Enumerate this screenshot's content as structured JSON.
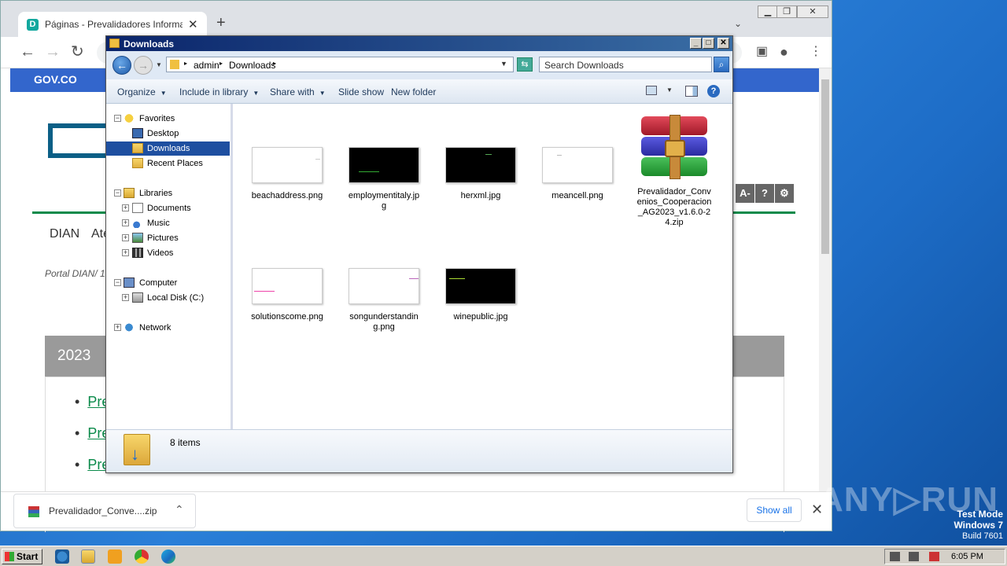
{
  "chrome": {
    "tab_title": "Páginas - Prevalidadores Informacion",
    "tab_favicon": "D",
    "new_tab_symbol": "+",
    "tab_close": "✕",
    "back": "←",
    "forward": "→",
    "reload": "↻"
  },
  "webpage": {
    "gov_label": "GOV.CO",
    "menu_dian": "DIAN",
    "menu_partial": "Ate",
    "breadcrumb": "Portal DIAN/   1",
    "year_heading": "2023",
    "link_items": [
      "Pre",
      "Pre",
      "Pre"
    ],
    "access_buttons": [
      "A-",
      "?",
      "⚙"
    ]
  },
  "download_shelf": {
    "item_name": "Prevalidador_Conve....zip",
    "show_all": "Show all",
    "close": "✕"
  },
  "explorer": {
    "title": "Downloads",
    "path": [
      "admin",
      "Downloads"
    ],
    "search_placeholder": "Search Downloads",
    "commands": {
      "organize": "Organize",
      "include_library": "Include in library",
      "share_with": "Share with",
      "slide_show": "Slide show",
      "new_folder": "New folder"
    },
    "nav": {
      "favorites": "Favorites",
      "desktop": "Desktop",
      "downloads": "Downloads",
      "recent_places": "Recent Places",
      "libraries": "Libraries",
      "documents": "Documents",
      "music": "Music",
      "pictures": "Pictures",
      "videos": "Videos",
      "computer": "Computer",
      "local_disk": "Local Disk (C:)",
      "network": "Network"
    },
    "files": [
      {
        "name": "beachaddress.png",
        "thumb": "white"
      },
      {
        "name": "employmentitaly.jpg",
        "thumb": "black"
      },
      {
        "name": "herxml.jpg",
        "thumb": "black"
      },
      {
        "name": "meancell.png",
        "thumb": "white"
      },
      {
        "name": "Prevalidador_Convenios_Cooperacion_AG2023_v1.6.0-24.zip",
        "thumb": "winrar"
      },
      {
        "name": "solutionscome.png",
        "thumb": "white"
      },
      {
        "name": "songunderstanding.png",
        "thumb": "white"
      },
      {
        "name": "winepublic.jpg",
        "thumb": "black"
      }
    ],
    "item_count": "8 items"
  },
  "desktop": {
    "watermark": "ANY RUN",
    "test_mode_line1": "Test Mode",
    "test_mode_line2": "Windows 7",
    "test_mode_line3": "Build 7601"
  },
  "taskbar": {
    "start_label": "Start",
    "clock": "6:05 PM"
  },
  "colors": {
    "desktop_blue": "#1d6cc6",
    "explorer_title": "#0a246a",
    "nav_selected": "#1e4fa0",
    "gov_blue": "#3366cc",
    "dian_green": "#0a8a4a"
  }
}
